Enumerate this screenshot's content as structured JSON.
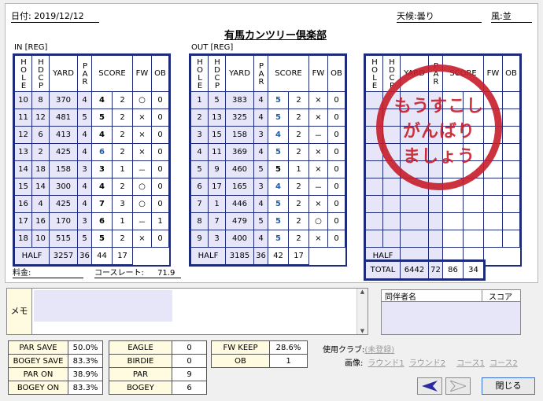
{
  "header": {
    "date_label": "日付:",
    "date": "2019/12/12",
    "weather_label": "天候:",
    "weather": "曇り",
    "wind_label": "風:",
    "wind": "並"
  },
  "course_name": "有馬カンツリー倶楽部",
  "in_label": "IN [REG]",
  "out_label": "OUT [REG]",
  "columns": {
    "hole": "HOLE",
    "hdcp": "HDCP",
    "yard": "YARD",
    "par": "PAR",
    "score": "SCORE",
    "fw": "FW",
    "ob": "OB"
  },
  "in_holes": [
    {
      "hole": "10",
      "hdcp": "8",
      "yard": "370",
      "par": "4",
      "score": "4",
      "putt": "2",
      "fw": "○",
      "ob": "0",
      "style": "blk"
    },
    {
      "hole": "11",
      "hdcp": "12",
      "yard": "481",
      "par": "5",
      "score": "5",
      "putt": "2",
      "fw": "×",
      "ob": "0",
      "style": "blk"
    },
    {
      "hole": "12",
      "hdcp": "6",
      "yard": "413",
      "par": "4",
      "score": "4",
      "putt": "2",
      "fw": "×",
      "ob": "0",
      "style": "blk"
    },
    {
      "hole": "13",
      "hdcp": "2",
      "yard": "425",
      "par": "4",
      "score": "6",
      "putt": "2",
      "fw": "×",
      "ob": "0",
      "style": "blue"
    },
    {
      "hole": "14",
      "hdcp": "18",
      "yard": "158",
      "par": "3",
      "score": "3",
      "putt": "1",
      "fw": "－",
      "ob": "0",
      "style": "blk"
    },
    {
      "hole": "15",
      "hdcp": "14",
      "yard": "300",
      "par": "4",
      "score": "4",
      "putt": "2",
      "fw": "○",
      "ob": "0",
      "style": "blk"
    },
    {
      "hole": "16",
      "hdcp": "4",
      "yard": "425",
      "par": "4",
      "score": "7",
      "putt": "3",
      "fw": "○",
      "ob": "0",
      "style": "blk"
    },
    {
      "hole": "17",
      "hdcp": "16",
      "yard": "170",
      "par": "3",
      "score": "6",
      "putt": "1",
      "fw": "－",
      "ob": "1",
      "style": "blk"
    },
    {
      "hole": "18",
      "hdcp": "10",
      "yard": "515",
      "par": "5",
      "score": "5",
      "putt": "2",
      "fw": "×",
      "ob": "0",
      "style": "blk"
    }
  ],
  "in_half": {
    "label": "HALF",
    "yard": "3257",
    "par": "36",
    "score": "44",
    "putt": "17"
  },
  "out_holes": [
    {
      "hole": "1",
      "hdcp": "5",
      "yard": "383",
      "par": "4",
      "score": "5",
      "putt": "2",
      "fw": "×",
      "ob": "0",
      "style": "blue"
    },
    {
      "hole": "2",
      "hdcp": "13",
      "yard": "325",
      "par": "4",
      "score": "5",
      "putt": "2",
      "fw": "×",
      "ob": "0",
      "style": "blue"
    },
    {
      "hole": "3",
      "hdcp": "15",
      "yard": "158",
      "par": "3",
      "score": "4",
      "putt": "2",
      "fw": "－",
      "ob": "0",
      "style": "blue"
    },
    {
      "hole": "4",
      "hdcp": "11",
      "yard": "369",
      "par": "4",
      "score": "5",
      "putt": "2",
      "fw": "×",
      "ob": "0",
      "style": "blue"
    },
    {
      "hole": "5",
      "hdcp": "9",
      "yard": "460",
      "par": "5",
      "score": "5",
      "putt": "1",
      "fw": "×",
      "ob": "0",
      "style": "blk"
    },
    {
      "hole": "6",
      "hdcp": "17",
      "yard": "165",
      "par": "3",
      "score": "4",
      "putt": "2",
      "fw": "－",
      "ob": "0",
      "style": "blue"
    },
    {
      "hole": "7",
      "hdcp": "1",
      "yard": "446",
      "par": "4",
      "score": "5",
      "putt": "2",
      "fw": "×",
      "ob": "0",
      "style": "blue"
    },
    {
      "hole": "8",
      "hdcp": "7",
      "yard": "479",
      "par": "5",
      "score": "5",
      "putt": "2",
      "fw": "○",
      "ob": "0",
      "style": "blue"
    },
    {
      "hole": "9",
      "hdcp": "3",
      "yard": "400",
      "par": "4",
      "score": "5",
      "putt": "2",
      "fw": "×",
      "ob": "0",
      "style": "blue"
    }
  ],
  "out_half": {
    "label": "HALF",
    "yard": "3185",
    "par": "36",
    "score": "42",
    "putt": "17"
  },
  "extra_half_label": "HALF",
  "total": {
    "label": "TOTAL",
    "yard": "6442",
    "par": "72",
    "score": "86",
    "putt": "34"
  },
  "stamp": {
    "line1": "もうすこし",
    "line2": "がんばり",
    "line3": "ましょう"
  },
  "fee_label": "料金:",
  "course_rate_label": "コースレート:",
  "course_rate": "71.9",
  "memo_label": "メモ",
  "companions": {
    "name_header": "同伴者名",
    "score_header": "スコア"
  },
  "stats1": [
    {
      "label": "PAR SAVE",
      "value": "50.0%"
    },
    {
      "label": "BOGEY SAVE",
      "value": "83.3%"
    },
    {
      "label": "PAR ON",
      "value": "38.9%"
    },
    {
      "label": "BOGEY ON",
      "value": "83.3%"
    }
  ],
  "stats2": [
    {
      "label": "EAGLE",
      "value": "0"
    },
    {
      "label": "BIRDIE",
      "value": "0"
    },
    {
      "label": "PAR",
      "value": "9"
    },
    {
      "label": "BOGEY",
      "value": "6"
    }
  ],
  "stats3": [
    {
      "label": "FW KEEP",
      "value": "28.6%"
    },
    {
      "label": "OB",
      "value": "1"
    }
  ],
  "club_label": "使用クラブ:",
  "club_value": "(未登録)",
  "image_label": "画像:",
  "image_links": [
    "ラウンド1",
    "ラウンド2",
    "コース1",
    "コース2"
  ],
  "close_button": "閉じる",
  "accent_blue": "#1e2a7a",
  "stamp_red": "#c81e2a"
}
